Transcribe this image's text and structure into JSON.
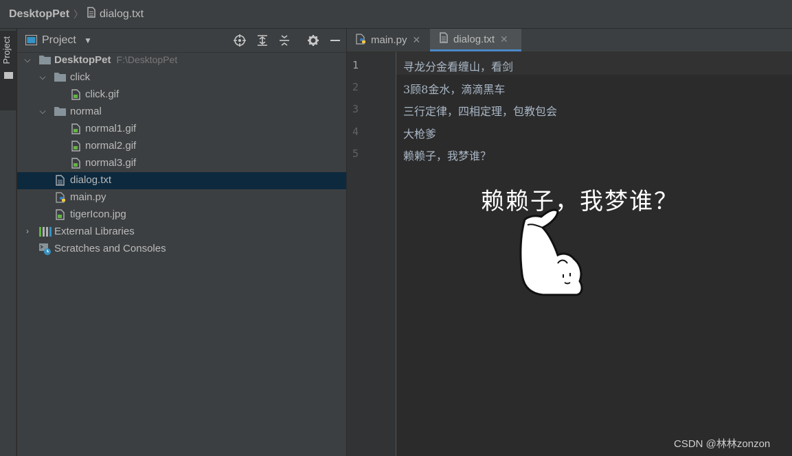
{
  "breadcrumb": {
    "project": "DesktopPet",
    "file": "dialog.txt"
  },
  "sidebar_strip": {
    "label": "Project"
  },
  "project_panel": {
    "title": "Project",
    "tree": [
      {
        "label": "DesktopPet",
        "path": "F:\\DesktopPet",
        "type": "folder",
        "expanded": true
      },
      {
        "label": "click",
        "type": "folder",
        "expanded": true
      },
      {
        "label": "click.gif",
        "type": "gif"
      },
      {
        "label": "normal",
        "type": "folder",
        "expanded": true
      },
      {
        "label": "normal1.gif",
        "type": "gif"
      },
      {
        "label": "normal2.gif",
        "type": "gif"
      },
      {
        "label": "normal3.gif",
        "type": "gif"
      },
      {
        "label": "dialog.txt",
        "type": "text",
        "selected": true
      },
      {
        "label": "main.py",
        "type": "python"
      },
      {
        "label": "tigerIcon.jpg",
        "type": "image"
      },
      {
        "label": "External Libraries",
        "type": "libraries",
        "expanded": false
      },
      {
        "label": "Scratches and Consoles",
        "type": "scratches"
      }
    ]
  },
  "tabs": [
    {
      "label": "main.py",
      "active": false
    },
    {
      "label": "dialog.txt",
      "active": true
    }
  ],
  "editor": {
    "line_numbers": [
      "1",
      "2",
      "3",
      "4",
      "5"
    ],
    "lines": [
      "寻龙分金看缠山，看剑",
      "3顾8金水，滴滴黑车",
      "三行定律，四相定理，包教包会",
      "大枪爹",
      "赖赖子，我梦谁？"
    ],
    "current_line": 1
  },
  "overlay": {
    "text": "赖赖子，我梦谁？"
  },
  "watermark": "CSDN @林林zonzon",
  "colors": {
    "background": "#2b2b2b",
    "panel": "#3c3f41",
    "selection": "#0d293e",
    "tab_underline": "#4a88c7",
    "code_text": "#a9b7c6"
  }
}
